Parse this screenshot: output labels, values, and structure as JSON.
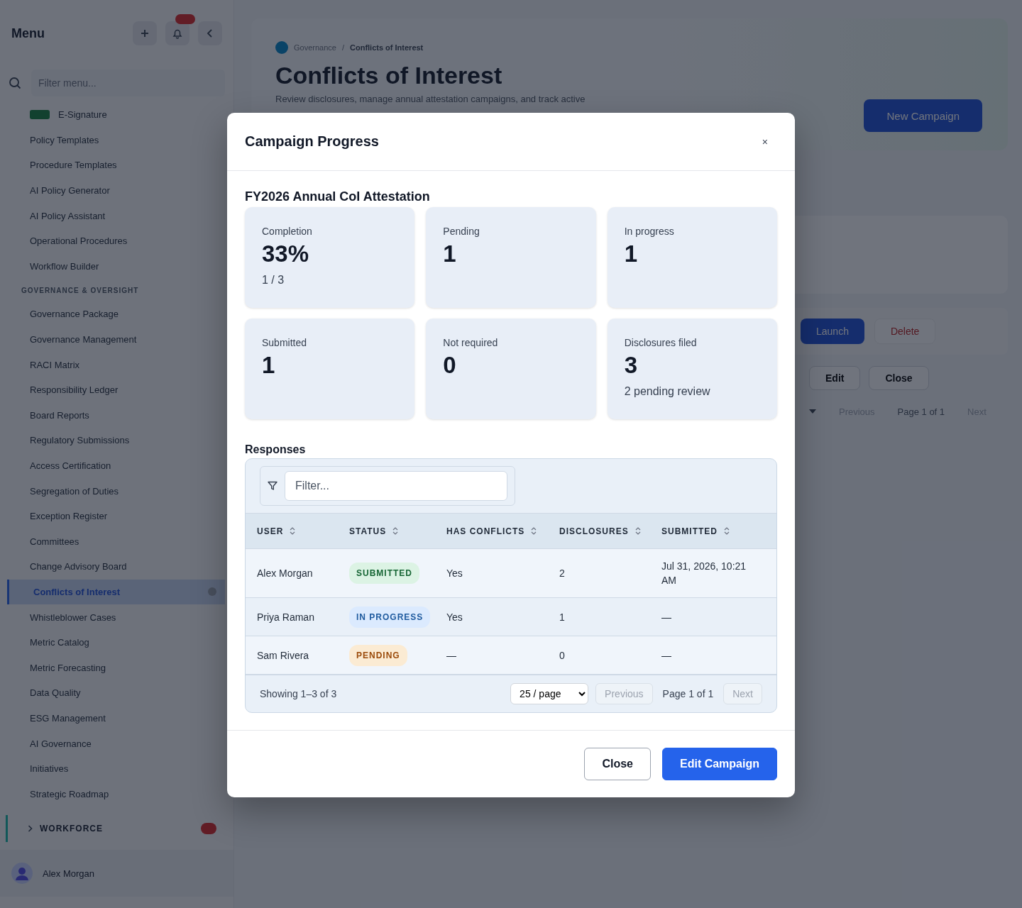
{
  "sidebar": {
    "title": "Menu",
    "filter_placeholder": "Filter menu...",
    "items": [
      {
        "kind": "tagged",
        "label": "E-Signature",
        "selected": false
      },
      {
        "kind": "item",
        "label": "Policy Templates",
        "selected": false
      },
      {
        "kind": "item",
        "label": "Procedure Templates",
        "selected": false
      },
      {
        "kind": "item",
        "label": "AI Policy Generator",
        "selected": false
      },
      {
        "kind": "item",
        "label": "AI Policy Assistant",
        "selected": false
      },
      {
        "kind": "item",
        "label": "Operational Procedures",
        "selected": false
      },
      {
        "kind": "item",
        "label": "Workflow Builder",
        "selected": false
      },
      {
        "kind": "section",
        "label": "GOVERNANCE & OVERSIGHT"
      },
      {
        "kind": "item",
        "label": "Governance Package",
        "selected": false
      },
      {
        "kind": "item",
        "label": "Governance Management",
        "selected": false
      },
      {
        "kind": "item",
        "label": "RACI Matrix",
        "selected": false
      },
      {
        "kind": "item",
        "label": "Responsibility Ledger",
        "selected": false
      },
      {
        "kind": "item",
        "label": "Board Reports",
        "selected": false
      },
      {
        "kind": "item",
        "label": "Regulatory Submissions",
        "selected": false
      },
      {
        "kind": "item",
        "label": "Access Certification",
        "selected": false
      },
      {
        "kind": "item",
        "label": "Segregation of Duties",
        "selected": false
      },
      {
        "kind": "item",
        "label": "Exception Register",
        "selected": false
      },
      {
        "kind": "item",
        "label": "Committees",
        "selected": false
      },
      {
        "kind": "item",
        "label": "Change Advisory Board",
        "selected": false
      },
      {
        "kind": "item",
        "label": "Conflicts of Interest",
        "selected": true
      },
      {
        "kind": "item",
        "label": "Whistleblower Cases",
        "selected": false
      },
      {
        "kind": "item",
        "label": "Metric Catalog",
        "selected": false
      },
      {
        "kind": "item",
        "label": "Metric Forecasting",
        "selected": false
      },
      {
        "kind": "item",
        "label": "Data Quality",
        "selected": false
      },
      {
        "kind": "item",
        "label": "ESG Management",
        "selected": false
      },
      {
        "kind": "item",
        "label": "AI Governance",
        "selected": false
      },
      {
        "kind": "item",
        "label": "Initiatives",
        "selected": false
      },
      {
        "kind": "item",
        "label": "Strategic Roadmap",
        "selected": false
      },
      {
        "kind": "group",
        "label": "WORKFORCE"
      }
    ],
    "user": "Alex Morgan"
  },
  "page": {
    "breadcrumb": [
      "Governance",
      "Conflicts of Interest"
    ],
    "breadcrumb_separator": "/",
    "title": "Conflicts of Interest",
    "subtitle": "Review disclosures, manage annual attestation campaigns, and track active",
    "primary_action": "New Campaign",
    "campaign_actions": [
      "Launch",
      "Delete"
    ],
    "row_actions": [
      "Edit",
      "Close"
    ],
    "pager": {
      "previous": "Previous",
      "page": "Page 1 of 1",
      "next": "Next"
    }
  },
  "modal": {
    "title": "Campaign Progress",
    "close": "×",
    "campaign": "FY2026 Annual CoI Attestation",
    "stats": [
      {
        "label": "Completion",
        "value": "33%",
        "note": "1 / 3"
      },
      {
        "label": "Pending",
        "value": "1"
      },
      {
        "label": "In progress",
        "value": "1"
      },
      {
        "label": "Submitted",
        "value": "1"
      },
      {
        "label": "Not required",
        "value": "0"
      },
      {
        "label": "Disclosures filed",
        "value": "3",
        "note": "2 pending review"
      }
    ],
    "responses": {
      "title": "Responses",
      "filter_placeholder": "Filter...",
      "columns": [
        "USER",
        "STATUS",
        "HAS CONFLICTS",
        "DISCLOSURES",
        "SUBMITTED"
      ],
      "rows": [
        {
          "user": "Alex Morgan",
          "status": {
            "label": "SUBMITTED",
            "kind": "submitted"
          },
          "has_conflicts": "Yes",
          "disclosures": "2",
          "submitted": "Jul 31, 2026, 10:21 AM"
        },
        {
          "user": "Priya Raman",
          "status": {
            "label": "IN PROGRESS",
            "kind": "in_progress"
          },
          "has_conflicts": "Yes",
          "disclosures": "1",
          "submitted": "—"
        },
        {
          "user": "Sam Rivera",
          "status": {
            "label": "PENDING",
            "kind": "pending"
          },
          "has_conflicts": "—",
          "disclosures": "0",
          "submitted": "—"
        }
      ],
      "footer": {
        "showing": "Showing 1–3 of 3",
        "page_size": "25 / page",
        "previous": {
          "label": "Previous",
          "disabled": true
        },
        "page": "Page 1 of 1",
        "next": {
          "label": "Next",
          "disabled": true
        }
      }
    },
    "buttons": [
      {
        "label": "Close",
        "kind": "secondary"
      },
      {
        "label": "Edit Campaign",
        "kind": "primary"
      }
    ]
  }
}
